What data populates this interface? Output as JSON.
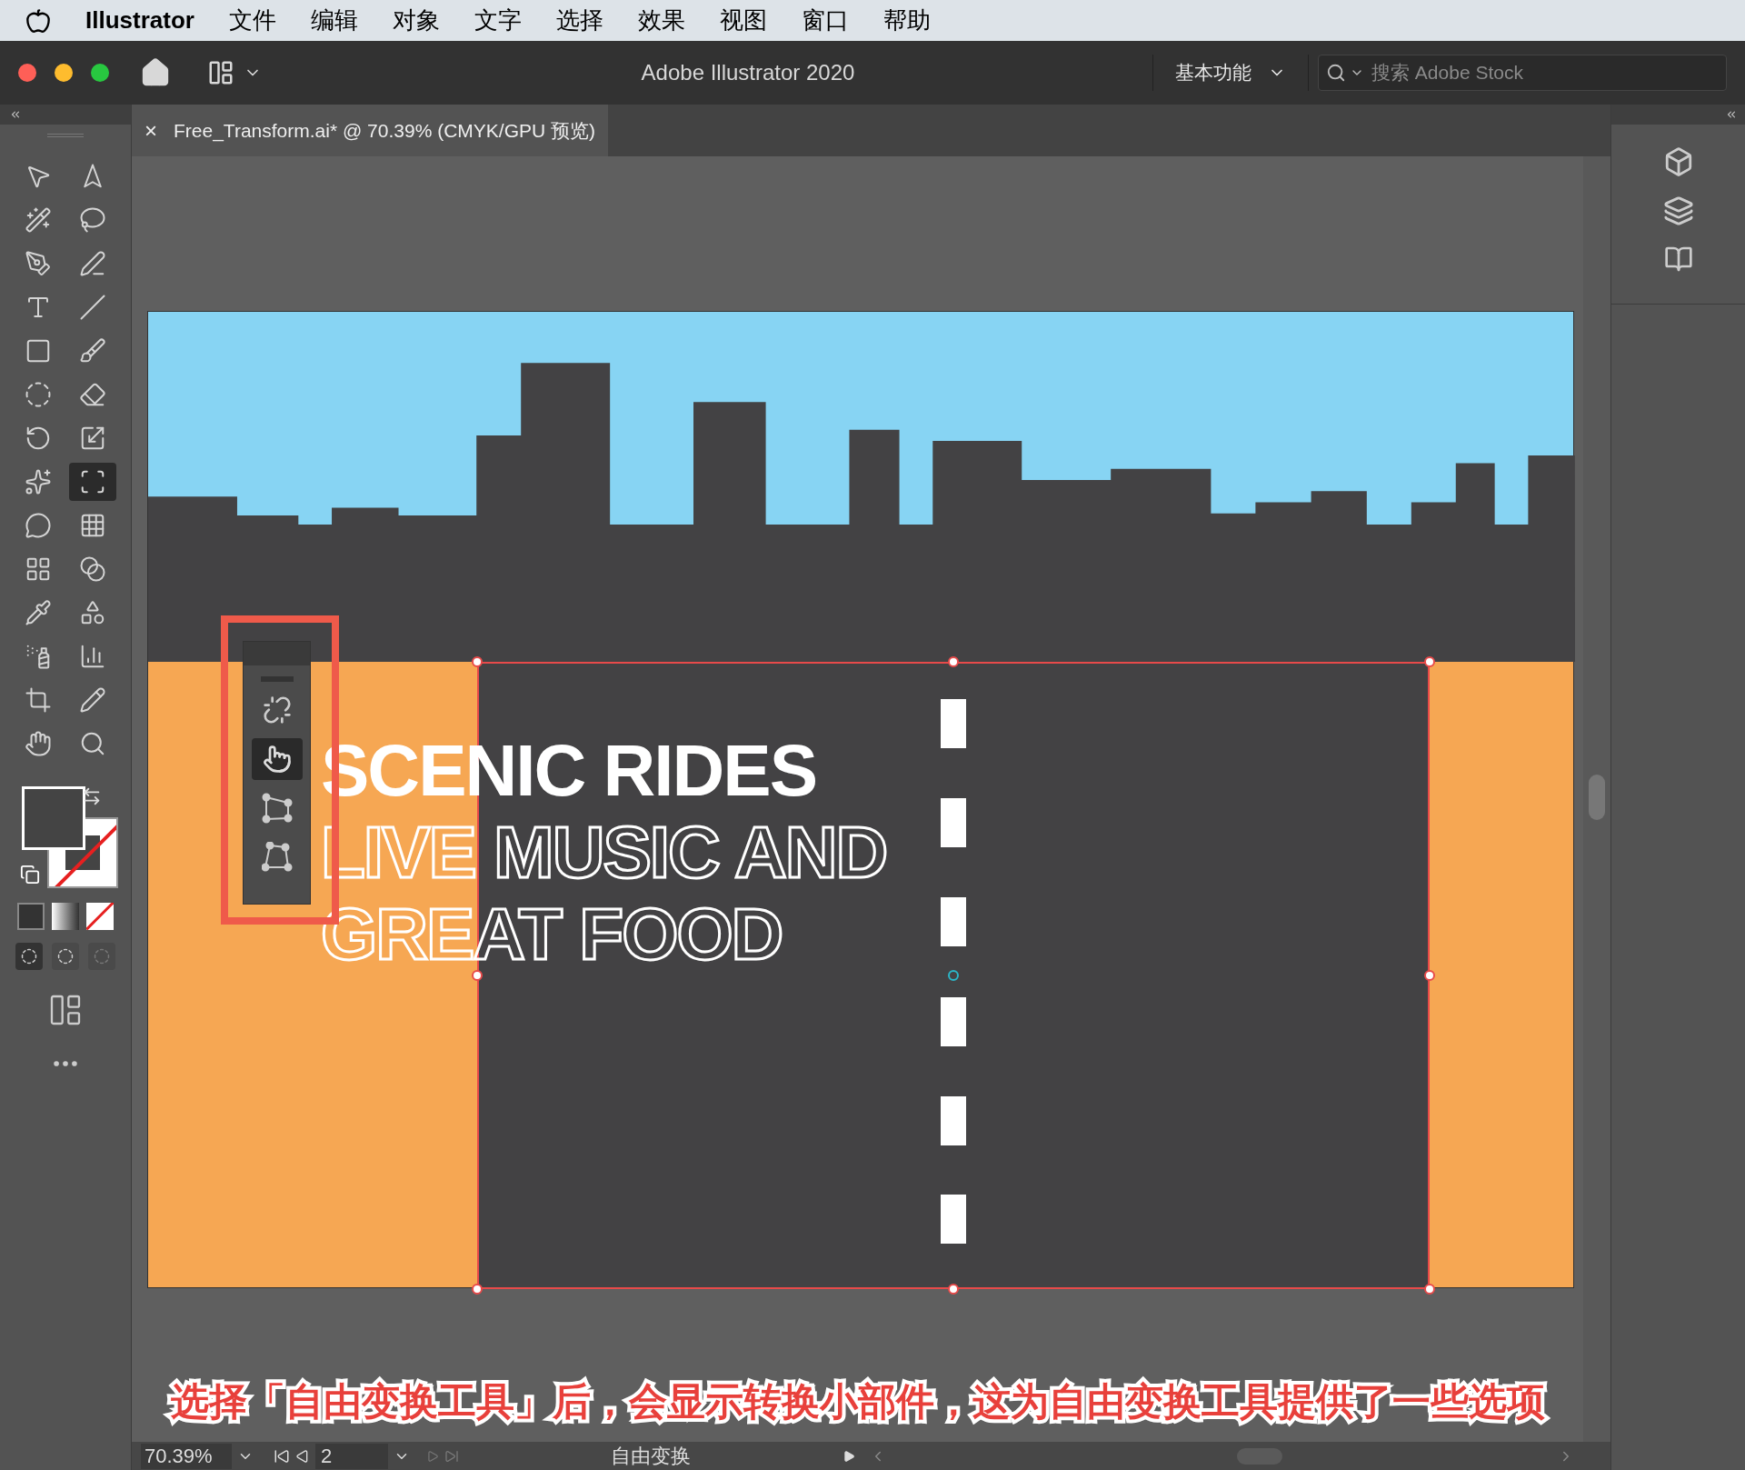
{
  "menu_bar": {
    "app_name": "Illustrator",
    "items": [
      "文件",
      "编辑",
      "对象",
      "文字",
      "选择",
      "效果",
      "视图",
      "窗口",
      "帮助"
    ]
  },
  "title_bar": {
    "title": "Adobe Illustrator 2020",
    "workspace": "基本功能",
    "search": {
      "placeholder": "搜索 Adobe Stock"
    }
  },
  "document_tab": {
    "close": "×",
    "label": "Free_Transform.ai* @ 70.39% (CMYK/GPU 预览)",
    "selected": true
  },
  "tools": [
    {
      "selected": false
    },
    {
      "selected": false
    },
    {
      "selected": false
    },
    {
      "selected": false
    },
    {
      "selected": false
    },
    {
      "selected": false
    },
    {
      "selected": false
    },
    {
      "selected": false
    },
    {
      "selected": false
    },
    {
      "selected": false
    },
    {
      "selected": false
    },
    {
      "selected": false
    },
    {
      "selected": false
    },
    {
      "selected": false
    },
    {
      "selected": false
    },
    {
      "selected": true
    },
    {
      "selected": false
    },
    {
      "selected": false
    },
    {
      "selected": false
    },
    {
      "selected": false
    },
    {
      "selected": false
    },
    {
      "selected": false
    },
    {
      "selected": false
    },
    {
      "selected": false
    },
    {
      "selected": false
    },
    {
      "selected": false
    },
    {
      "selected": false
    },
    {
      "selected": false
    }
  ],
  "artboard": {
    "headline": "SCENIC RIDES",
    "lines": [
      "LIVE MUSIC AND",
      "GREAT FOOD"
    ]
  },
  "widget": {
    "buttons": [
      {
        "selected": false
      },
      {
        "selected": true
      },
      {
        "selected": false
      },
      {
        "selected": false
      }
    ]
  },
  "caption": "选择「自由变换工具」后，会显示转换小部件，这为自由变换工具提供了一些选项",
  "status_bar": {
    "zoom": "70.39%",
    "page": "2",
    "tool": "自由变换"
  }
}
